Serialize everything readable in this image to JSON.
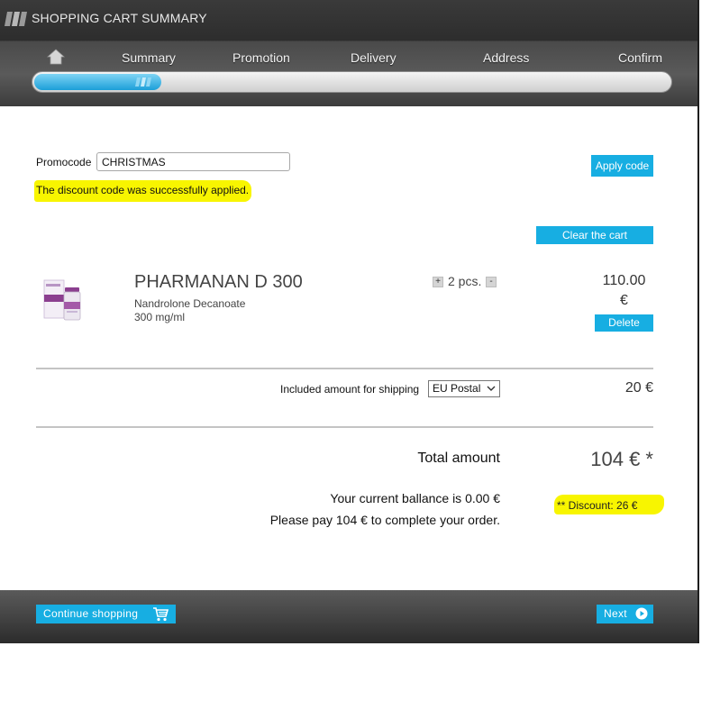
{
  "header": {
    "title": "SHOPPING CART SUMMARY",
    "logo": "logo-stripes-icon",
    "steps": [
      "Summary",
      "Promotion",
      "Delivery",
      "Address",
      "Confirm"
    ],
    "home_icon": "home-icon",
    "progress_fraction": 0.2
  },
  "promo": {
    "label": "Promocode",
    "value": "CHRISTMAS",
    "apply_label": "Apply code",
    "message": "The discount code was successfully applied."
  },
  "cart": {
    "clear_label": "Clear the cart",
    "items": [
      {
        "name": "PHARMANAN D 300",
        "description": "Nandrolone Decanoate",
        "strength": "300 mg/ml",
        "plus": "+",
        "quantity_text": "2 pcs.",
        "minus": "-",
        "price": "110.00",
        "currency": "€",
        "delete_label": "Delete"
      }
    ]
  },
  "shipping": {
    "label": "Included amount for shipping",
    "selected": "EU Postal",
    "price": "20 €"
  },
  "totals": {
    "total_label": "Total amount",
    "total_value": "104 € *",
    "balance_text": "Your current ballance is 0.00 €",
    "pay_text": "Please pay 104 € to complete your order.",
    "discount_text": "** Discount: 26 €"
  },
  "footer": {
    "continue_label": "Continue shopping",
    "next_label": "Next"
  },
  "colors": {
    "accent": "#17aee2",
    "highlight": "#f8f500",
    "header_dark": "#2d2d2d"
  }
}
